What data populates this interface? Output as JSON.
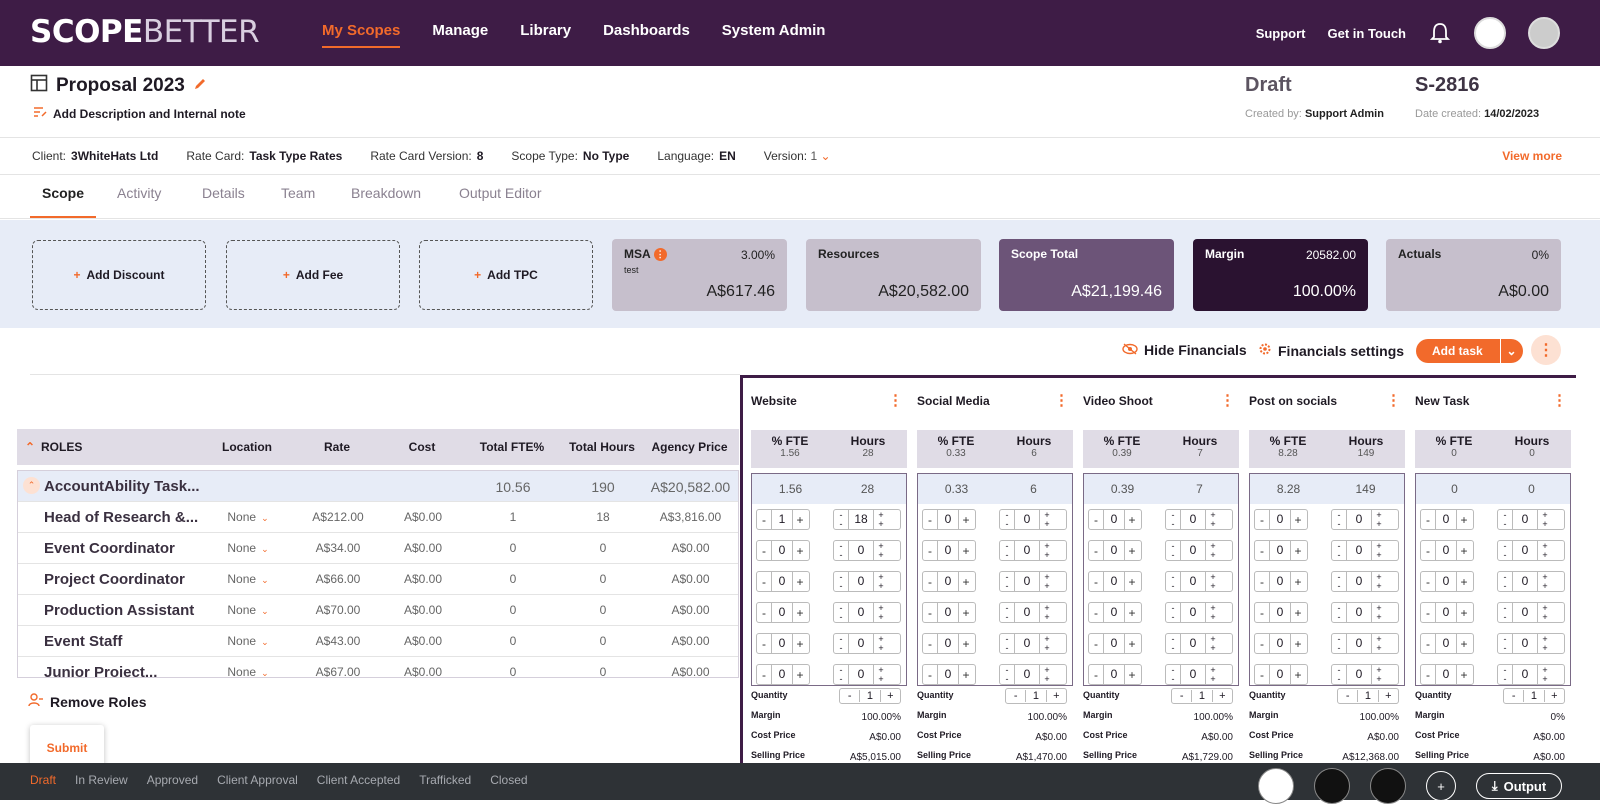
{
  "nav": {
    "logo_a": "SCOPE",
    "logo_b": "BETTER",
    "links": [
      "My Scopes",
      "Manage",
      "Library",
      "Dashboards",
      "System Admin"
    ],
    "support": "Support",
    "get_in_touch": "Get in Touch"
  },
  "header": {
    "title": "Proposal 2023",
    "desc": "Add Description and Internal note",
    "status": "Draft",
    "scope_id": "S-2816",
    "created_by_label": "Created by:",
    "created_by": "Support Admin",
    "date_label": "Date created:",
    "date": "14/02/2023"
  },
  "meta": {
    "client_label": "Client:",
    "client": "3WhiteHats Ltd",
    "rate_card_label": "Rate Card:",
    "rate_card": "Task Type Rates",
    "rcv_label": "Rate Card Version:",
    "rcv": "8",
    "scope_type_label": "Scope Type:",
    "scope_type": "No Type",
    "lang_label": "Language:",
    "lang": "EN",
    "version_label": "Version:",
    "version": "1",
    "view_more": "View more"
  },
  "tabs": [
    "Scope",
    "Activity",
    "Details",
    "Team",
    "Breakdown",
    "Output Editor"
  ],
  "summary": {
    "add_discount": "Add Discount",
    "add_fee": "Add Fee",
    "add_tpc": "Add TPC",
    "cards": [
      {
        "title": "MSA",
        "pct": "3.00%",
        "sub": "test",
        "value": "A$617.46"
      },
      {
        "title": "Resources",
        "pct": "",
        "sub": "",
        "value": "A$20,582.00"
      },
      {
        "title": "Scope Total",
        "pct": "",
        "sub": "",
        "value": "A$21,199.46"
      },
      {
        "title": "Margin",
        "pct": "20582.00",
        "sub": "",
        "value": "100.00%"
      },
      {
        "title": "Actuals",
        "pct": "0%",
        "sub": "",
        "value": "A$0.00"
      }
    ]
  },
  "toolbar": {
    "hide_financials": "Hide Financials",
    "financials_settings": "Financials settings",
    "add_task": "Add task"
  },
  "roles_table": {
    "headers": [
      "ROLES",
      "Location",
      "Rate",
      "Cost",
      "Total FTE%",
      "Total Hours",
      "Agency Price"
    ],
    "group": {
      "name": "AccountAbility Task...",
      "fte": "10.56",
      "hours": "190",
      "price": "A$20,582.00"
    },
    "rows": [
      {
        "name": "Head of Research &...",
        "loc": "None",
        "rate": "A$212.00",
        "cost": "A$0.00",
        "fte": "1",
        "hours": "18",
        "price": "A$3,816.00"
      },
      {
        "name": "Event Coordinator",
        "loc": "None",
        "rate": "A$34.00",
        "cost": "A$0.00",
        "fte": "0",
        "hours": "0",
        "price": "A$0.00"
      },
      {
        "name": "Project Coordinator",
        "loc": "None",
        "rate": "A$66.00",
        "cost": "A$0.00",
        "fte": "0",
        "hours": "0",
        "price": "A$0.00"
      },
      {
        "name": "Production Assistant",
        "loc": "None",
        "rate": "A$70.00",
        "cost": "A$0.00",
        "fte": "0",
        "hours": "0",
        "price": "A$0.00"
      },
      {
        "name": "Event Staff",
        "loc": "None",
        "rate": "A$43.00",
        "cost": "A$0.00",
        "fte": "0",
        "hours": "0",
        "price": "A$0.00"
      },
      {
        "name": "Junior Project...",
        "loc": "None",
        "rate": "A$67.00",
        "cost": "A$0.00",
        "fte": "0",
        "hours": "0",
        "price": "A$0.00"
      }
    ],
    "remove_roles": "Remove Roles"
  },
  "submit": "Submit",
  "task_labels": {
    "fte": "% FTE",
    "hours": "Hours",
    "quantity": "Quantity",
    "margin": "Margin",
    "cost_price": "Cost Price",
    "selling_price": "Selling Price"
  },
  "tasks": [
    {
      "name": "Website",
      "fte": "1.56",
      "hours": "28",
      "row_fte": [
        "1",
        "0",
        "0",
        "0",
        "0",
        "0"
      ],
      "row_hours": [
        "18",
        "0",
        "0",
        "0",
        "0",
        "0"
      ],
      "qty": "1",
      "margin": "100.00%",
      "cost": "A$0.00",
      "sell": "A$5,015.00"
    },
    {
      "name": "Social Media",
      "fte": "0.33",
      "hours": "6",
      "row_fte": [
        "0",
        "0",
        "0",
        "0",
        "0",
        "0"
      ],
      "row_hours": [
        "0",
        "0",
        "0",
        "0",
        "0",
        "0"
      ],
      "qty": "1",
      "margin": "100.00%",
      "cost": "A$0.00",
      "sell": "A$1,470.00"
    },
    {
      "name": "Video Shoot",
      "fte": "0.39",
      "hours": "7",
      "row_fte": [
        "0",
        "0",
        "0",
        "0",
        "0",
        "0"
      ],
      "row_hours": [
        "0",
        "0",
        "0",
        "0",
        "0",
        "0"
      ],
      "qty": "1",
      "margin": "100.00%",
      "cost": "A$0.00",
      "sell": "A$1,729.00"
    },
    {
      "name": "Post on socials",
      "fte": "8.28",
      "hours": "149",
      "row_fte": [
        "0",
        "0",
        "0",
        "0",
        "0",
        "0"
      ],
      "row_hours": [
        "0",
        "0",
        "0",
        "0",
        "0",
        "0"
      ],
      "qty": "1",
      "margin": "100.00%",
      "cost": "A$0.00",
      "sell": "A$12,368.00"
    },
    {
      "name": "New Task",
      "fte": "0",
      "hours": "0",
      "row_fte": [
        "0",
        "0",
        "0",
        "0",
        "0",
        "0"
      ],
      "row_hours": [
        "0",
        "0",
        "0",
        "0",
        "0",
        "0"
      ],
      "qty": "1",
      "margin": "0%",
      "cost": "A$0.00",
      "sell": "A$0.00"
    }
  ],
  "status_steps": [
    "Draft",
    "In Review",
    "Approved",
    "Client Approval",
    "Client Accepted",
    "Trafficked",
    "Closed"
  ],
  "output": "Output"
}
